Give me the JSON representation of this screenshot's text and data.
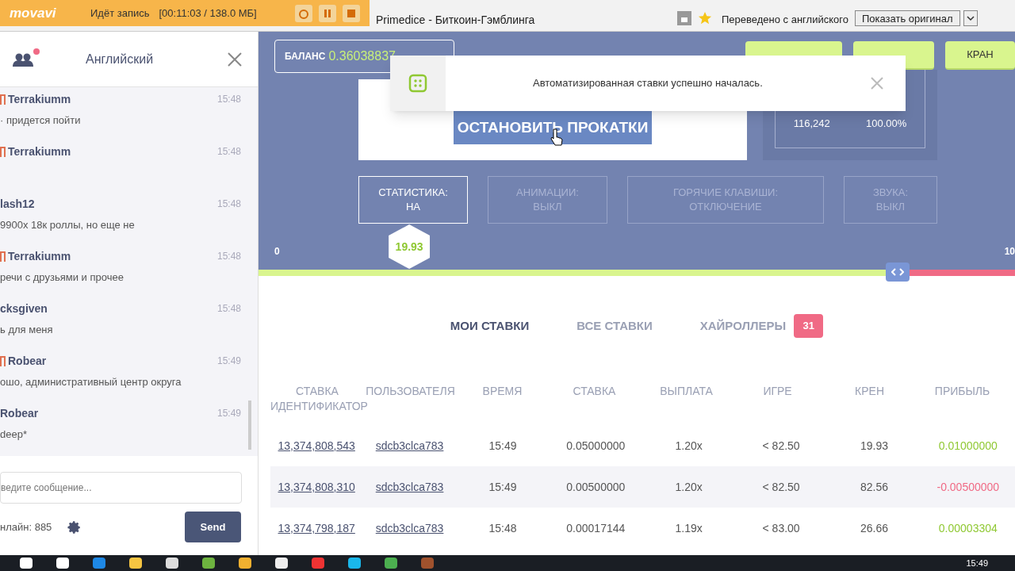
{
  "recorder": {
    "brand": "movavi",
    "status": "Идёт запись",
    "counter": "[00:11:03 / 138.0 МБ]"
  },
  "browser": {
    "title": "Primedice - Биткоин-Гэмблинга",
    "translate_note": "Переведено с английского",
    "show_original": "Показать оригинал"
  },
  "chat": {
    "title": "Английский",
    "notification": true,
    "messages": [
      {
        "name": "Terrakiumm",
        "flag": true,
        "time": "15:48",
        "text": "· придется пойти"
      },
      {
        "name": "Terrakiumm",
        "flag": true,
        "time": "15:48"
      },
      {
        "name": "lash12",
        "flag": false,
        "time": "15:48",
        "text": "9900х 18к роллы, но еще не"
      },
      {
        "name": "Terrakiumm",
        "flag": true,
        "time": "15:48",
        "text": "речи с друзьями и прочее"
      },
      {
        "name": "cksgiven",
        "flag": false,
        "time": "15:48",
        "text": "ь для меня"
      },
      {
        "name": "Robear",
        "flag": true,
        "time": "15:49",
        "text": "ошо, административный центр округа"
      },
      {
        "name": "Robear",
        "flag": false,
        "time": "15:49",
        "text": "deep*"
      }
    ],
    "input_placeholder": "ведите сообщение...",
    "online": "нлайн: 885",
    "send": "Send"
  },
  "header": {
    "balance_label": "БАЛАНС",
    "balance": "0.36038837",
    "buttons": [
      "КРАН"
    ]
  },
  "toast": {
    "message": "Автоматизированная ставки успешно началась."
  },
  "game": {
    "stop_button": "ОСТАНОВИТЬ ПРОКАТКИ",
    "stats": [
      "116,242",
      "100.00%"
    ]
  },
  "toggles": [
    {
      "label": "СТАТИСТИКА:",
      "value": "НА",
      "on": true
    },
    {
      "label": "АНИМАЦИИ:",
      "value": "ВЫКЛ",
      "on": false
    },
    {
      "label": "ГОРЯЧИЕ КЛАВИШИ:",
      "value": "ОТКЛЮЧЕНИЕ",
      "on": false
    },
    {
      "label": "ЗВУКА:",
      "value": "ВЫКЛ",
      "on": false
    }
  ],
  "slider": {
    "min": "0",
    "max": "10",
    "level": 0.845,
    "roll": "19.93"
  },
  "tabs": [
    {
      "label": "МОИ СТАВКИ",
      "selected": true
    },
    {
      "label": "ВСЕ СТАВКИ",
      "selected": false
    },
    {
      "label": "ХАЙРОЛЛЕРЫ",
      "selected": false,
      "badge": "31"
    }
  ],
  "table": {
    "columns": [
      "СТАВКА ИДЕНТИФИКАТОР",
      "ПОЛЬЗОВАТЕЛЯ",
      "ВРЕМЯ",
      "СТАВКА",
      "ВЫПЛАТА",
      "ИГРЕ",
      "КРЕН",
      "ПРИБЫЛЬ"
    ],
    "rows": [
      {
        "cells": [
          "13,374,808,543",
          "sdcb3clca783",
          "15:49",
          "0.05000000",
          "1.20x",
          "< 82.50",
          "19.93",
          "0.01000000"
        ],
        "color": "#8fc832"
      },
      {
        "cells": [
          "13,374,808,310",
          "sdcb3clca783",
          "15:49",
          "0.00500000",
          "1.20x",
          "< 82.50",
          "82.56",
          "-0.00500000"
        ],
        "color": "#f06a85"
      },
      {
        "cells": [
          "13,374,798,187",
          "sdcb3clca783",
          "15:48",
          "0.00017144",
          "1.19x",
          "< 83.00",
          "26.66",
          "0.00003304"
        ],
        "color": "#8fc832"
      }
    ]
  },
  "taskbar": {
    "clock": "15:49"
  }
}
